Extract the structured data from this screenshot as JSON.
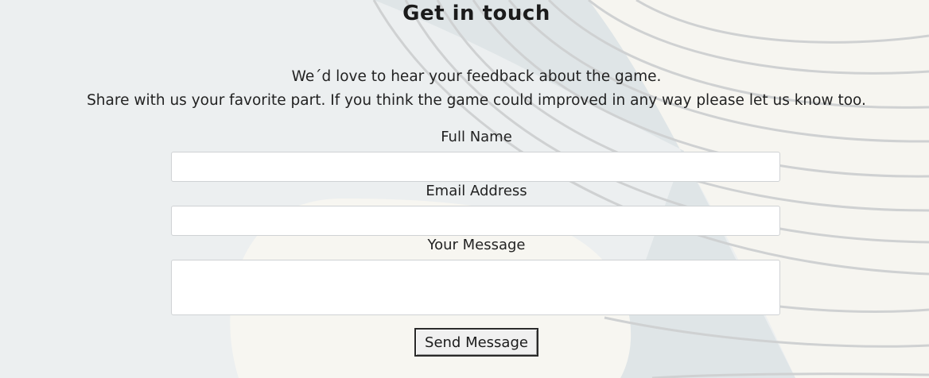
{
  "contact": {
    "title": "Get in touch",
    "intro_line_1": "We´d love to hear your feedback about the game.",
    "intro_line_2": "Share with us your favorite part. If you think the game could improved in any way please let us know too."
  },
  "form": {
    "full_name_label": "Full Name",
    "full_name_value": "",
    "email_label": "Email Address",
    "email_value": "",
    "message_label": "Your Message",
    "message_value": "",
    "submit_label": "Send Message"
  },
  "colors": {
    "background": "#eceff0",
    "decor_shape": "#f7f6f1",
    "decor_dark_band": "#dde3e5",
    "decor_lines": "#cfd1d2",
    "field_border": "#cfd2d4",
    "text": "#1f1f1f"
  }
}
